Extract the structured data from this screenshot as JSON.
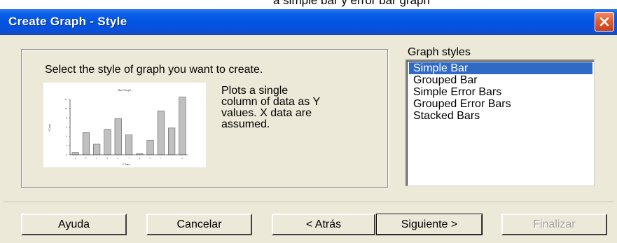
{
  "window": {
    "title": "Create Graph - Style",
    "cut_text_above": "a simple bar y error bar graph"
  },
  "content": {
    "prompt": "Select the style of graph you want to create.",
    "description_lines": [
      "Plots a single",
      "column of data as Y",
      "values.  X data are",
      "assumed."
    ],
    "preview_title": "Bar Graph",
    "preview_ylabel": "Y Data",
    "preview_xlabel": "X Data",
    "preview_yticks": [
      "12",
      "10",
      "8",
      "6",
      "4",
      "2",
      "0"
    ],
    "preview_xticks": [
      "a",
      "b",
      "c",
      "d",
      "e",
      "f",
      "g",
      "h",
      "i",
      "j",
      "k"
    ]
  },
  "graph_styles": {
    "label": "Graph styles",
    "items": [
      "Simple Bar",
      "Grouped Bar",
      "Simple Error Bars",
      "Grouped Error Bars",
      "Stacked Bars"
    ],
    "selected_index": 0
  },
  "buttons": {
    "help": "Ayuda",
    "cancel": "Cancelar",
    "back": "< Atrás",
    "next": "Siguiente >",
    "finish": "Finalizar"
  },
  "colors": {
    "titlebar": "#0054e3",
    "selection": "#316ac5",
    "dialog_bg": "#ece9d8",
    "close_button": "#e2582f",
    "bar_fill": "#c0c0c0"
  },
  "chart_data": {
    "type": "bar",
    "title": "Bar Graph",
    "xlabel": "X Data",
    "ylabel": "Y Data",
    "ylim": [
      0,
      12
    ],
    "values": [
      0.5,
      4.8,
      2.3,
      5.5,
      7.8,
      4.3,
      0.2,
      3.1,
      9.5,
      5.8,
      12.5
    ]
  }
}
